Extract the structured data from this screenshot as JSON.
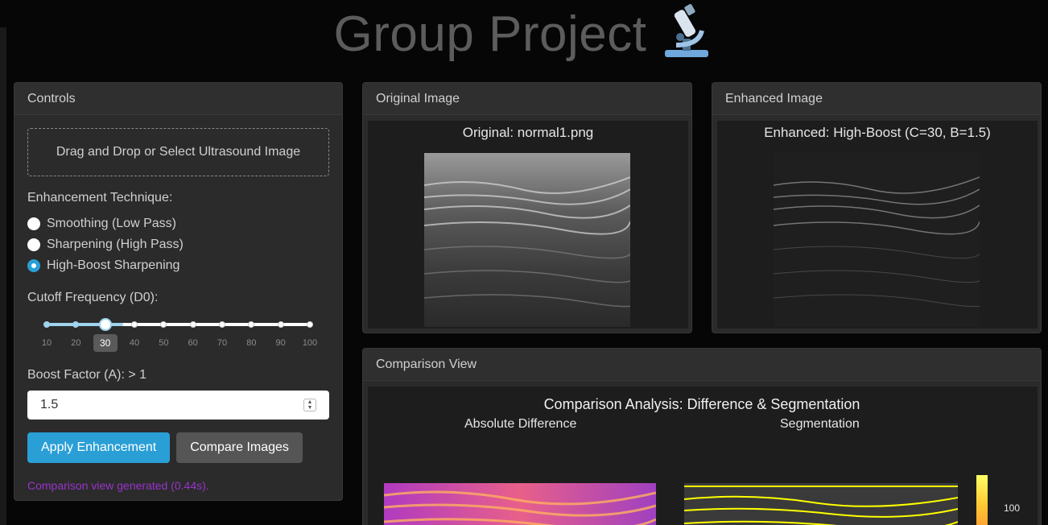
{
  "app": {
    "title": "Group Project",
    "title_icon": "microscope-icon"
  },
  "controls": {
    "header": "Controls",
    "dropzone_text": "Drag and Drop or Select Ultrasound Image",
    "technique_label": "Enhancement Technique:",
    "techniques": [
      {
        "label": "Smoothing (Low Pass)",
        "checked": false
      },
      {
        "label": "Sharpening (High Pass)",
        "checked": false
      },
      {
        "label": "High-Boost Sharpening",
        "checked": true
      }
    ],
    "cutoff_label": "Cutoff Frequency (D0):",
    "cutoff_ticks": [
      "10",
      "20",
      "30",
      "40",
      "50",
      "60",
      "70",
      "80",
      "90",
      "100"
    ],
    "cutoff_value": 30,
    "boost_label": "Boost Factor (A): > 1",
    "boost_value": "1.5",
    "apply_button": "Apply Enhancement",
    "compare_button": "Compare Images",
    "status": "Comparison view generated (0.44s).",
    "accent_color": "#2a9fd6",
    "status_color": "#9933cc"
  },
  "original": {
    "header": "Original Image",
    "caption": "Original: normal1.png"
  },
  "enhanced": {
    "header": "Enhanced Image",
    "caption": "Enhanced: High-Boost (C=30, B=1.5)"
  },
  "comparison": {
    "header": "Comparison View",
    "title": "Comparison Analysis: Difference & Segmentation",
    "left_subtitle": "Absolute Difference",
    "right_subtitle": "Segmentation",
    "colorbar_label": "100"
  }
}
